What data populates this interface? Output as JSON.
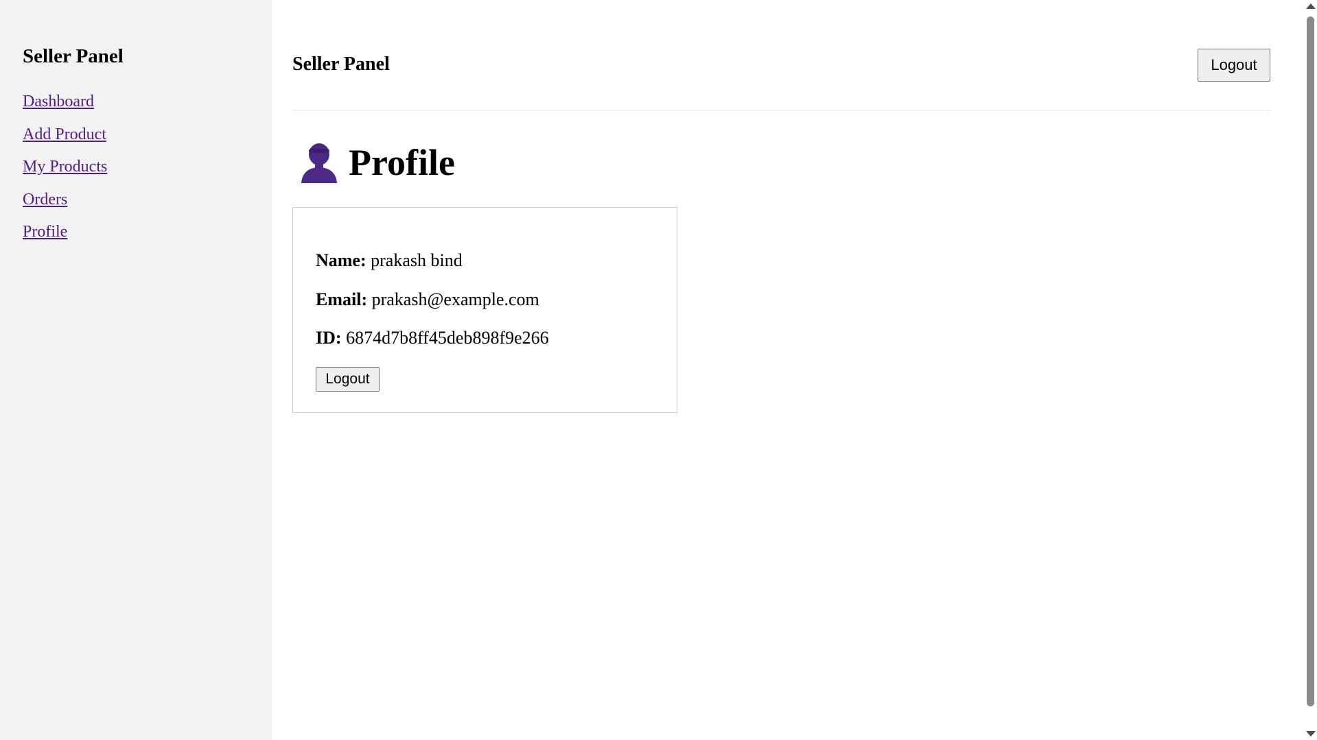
{
  "sidebar": {
    "title": "Seller Panel",
    "items": [
      {
        "label": "Dashboard"
      },
      {
        "label": "Add Product"
      },
      {
        "label": "My Products"
      },
      {
        "label": "Orders"
      },
      {
        "label": "Profile"
      }
    ]
  },
  "header": {
    "title": "Seller Panel",
    "logout_label": "Logout"
  },
  "profile": {
    "icon": "user-silhouette-icon",
    "heading": "Profile",
    "name_label": "Name:",
    "name_value": "prakash bind",
    "email_label": "Email:",
    "email_value": "prakash@example.com",
    "id_label": "ID:",
    "id_value": "6874d7b8ff45deb898f9e266",
    "logout_label": "Logout"
  },
  "colors": {
    "sidebar_bg": "#f2f2f2",
    "link": "#551a8b",
    "icon": "#4b2a85"
  }
}
